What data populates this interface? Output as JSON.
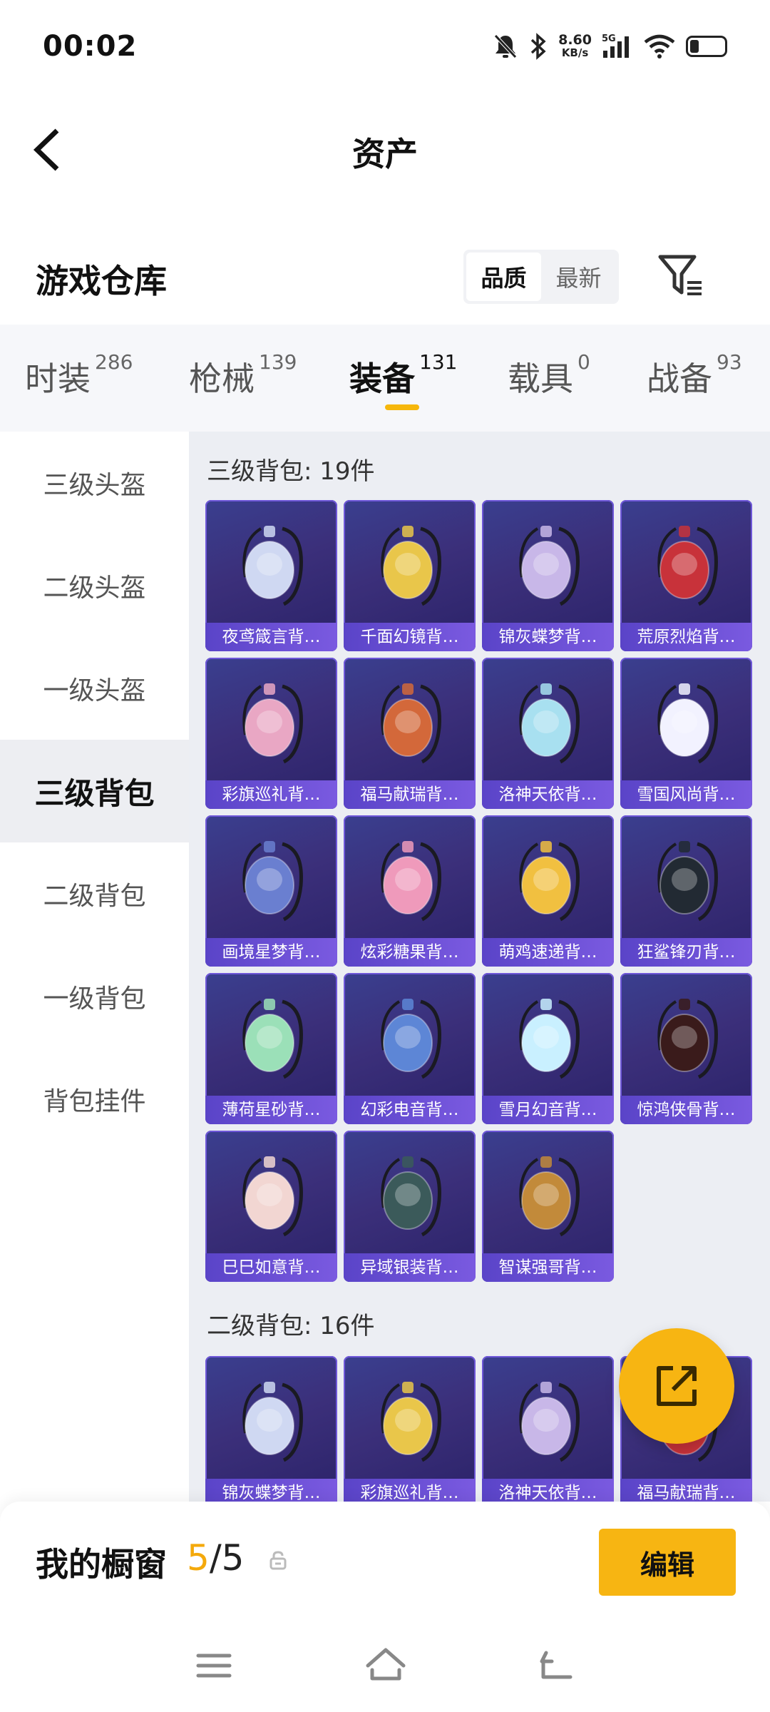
{
  "status_bar": {
    "time": "00:02",
    "net_speed": "8.60",
    "net_unit": "KB/s",
    "network": "5G"
  },
  "header": {
    "title": "资产"
  },
  "warehouse": {
    "title": "游戏仓库",
    "sort_options": [
      "品质",
      "最新"
    ],
    "active_sort": "品质"
  },
  "tabs": [
    {
      "label": "时装",
      "count": "286"
    },
    {
      "label": "枪械",
      "count": "139"
    },
    {
      "label": "装备",
      "count": "131"
    },
    {
      "label": "载具",
      "count": "0"
    },
    {
      "label": "战备",
      "count": "93"
    }
  ],
  "active_tab": "装备",
  "sidebar": [
    {
      "label": "三级头盔"
    },
    {
      "label": "二级头盔"
    },
    {
      "label": "一级头盔"
    },
    {
      "label": "三级背包"
    },
    {
      "label": "二级背包"
    },
    {
      "label": "一级背包"
    },
    {
      "label": "背包挂件"
    }
  ],
  "active_sidebar": "三级背包",
  "sections": [
    {
      "title": "三级背包: 19件",
      "items": [
        "夜鸢箴言背…",
        "千面幻镜背…",
        "锦灰蝶梦背…",
        "荒原烈焰背…",
        "彩旗巡礼背…",
        "福马献瑞背…",
        "洛神天依背…",
        "雪国风尚背…",
        "画境星梦背…",
        "炫彩糖果背…",
        "萌鸡速递背…",
        "狂鲨锋刃背…",
        "薄荷星砂背…",
        "幻彩电音背…",
        "雪月幻音背…",
        "惊鸿侠骨背…",
        "巳巳如意背…",
        "异域银装背…",
        "智谋强哥背…"
      ]
    },
    {
      "title": "二级背包: 16件",
      "items": [
        "锦灰蝶梦背…",
        "彩旗巡礼背…",
        "洛神天依背…",
        "福马献瑞背…"
      ]
    }
  ],
  "showcase": {
    "label": "我的橱窗",
    "count_current": "5",
    "count_sep": "/",
    "count_total": "5",
    "edit_label": "编辑"
  },
  "colors": {
    "accent": "#f7b512",
    "card_bg": "#3b2f7a",
    "card_label": "#6a4fd6"
  }
}
